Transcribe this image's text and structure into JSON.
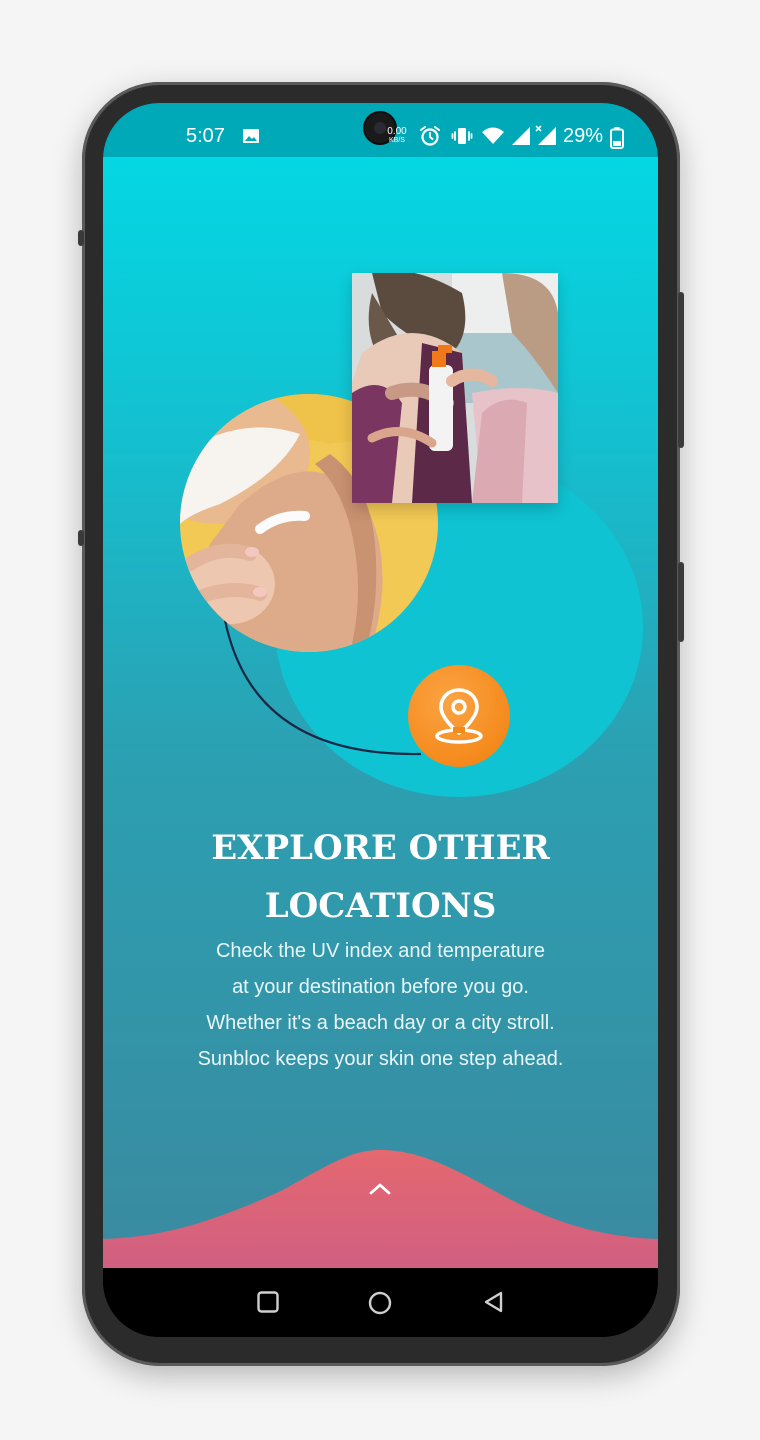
{
  "status_bar": {
    "time": "5:07",
    "speed_value": "0.00",
    "speed_unit": "KB/S",
    "battery_percent": "29%",
    "icons": [
      "image-icon",
      "alarm-icon",
      "vibrate-icon",
      "wifi-icon",
      "signal-icon",
      "signal-x-icon",
      "battery-icon"
    ]
  },
  "onboarding": {
    "title_line1": "EXPLORE OTHER",
    "title_line2": "LOCATIONS",
    "body_lines": [
      "Check the UV index and temperature",
      "at your destination before you go.",
      "Whether it's a beach day or a city stroll.",
      "Sunbloc keeps your skin one step ahead."
    ],
    "photos": [
      "sunscreen-on-shoulder-photo",
      "spray-sunscreen-on-back-photo"
    ],
    "badge_icon": "location-pin-icon",
    "next_icon": "chevron-up-icon"
  },
  "colors": {
    "gradient_top": "#04d7e3",
    "gradient_bottom": "#3a8aa0",
    "accent_orange": "#f58a1c",
    "wave_pink": "#de6873"
  },
  "nav_bar": {
    "icons": [
      "recents-square-icon",
      "home-circle-icon",
      "back-triangle-icon"
    ]
  }
}
